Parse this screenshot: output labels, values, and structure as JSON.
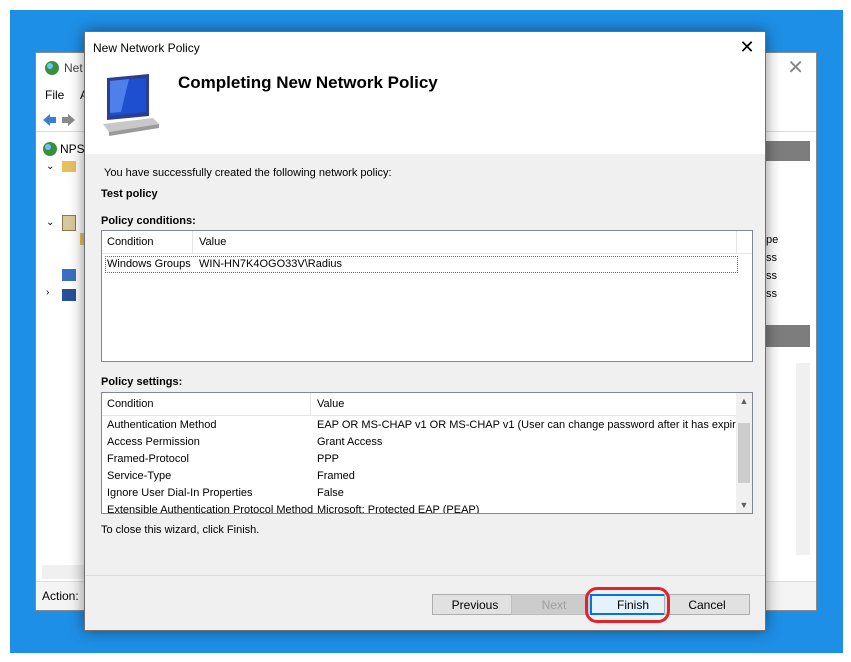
{
  "background_window": {
    "title": "Net",
    "menu": [
      "File",
      "A"
    ],
    "tree_root": "NPS",
    "right_items": [
      "pe",
      "ss",
      "ss",
      "ss"
    ],
    "status_label": "Action:"
  },
  "dialog": {
    "title": "New Network Policy",
    "heading": "Completing New Network Policy",
    "intro": "You have successfully created the following network policy:",
    "policy_name": "Test policy",
    "conditions_label": "Policy conditions:",
    "conditions_columns": [
      "Condition",
      "Value"
    ],
    "conditions_rows": [
      {
        "condition": "Windows Groups",
        "value": "WIN-HN7K4OGO33V\\Radius"
      }
    ],
    "settings_label": "Policy settings:",
    "settings_columns": [
      "Condition",
      "Value"
    ],
    "settings_rows": [
      {
        "condition": "Authentication Method",
        "value": "EAP OR MS-CHAP v1 OR MS-CHAP v1 (User can change password after it has expir..."
      },
      {
        "condition": "Access Permission",
        "value": "Grant Access"
      },
      {
        "condition": "Framed-Protocol",
        "value": "PPP"
      },
      {
        "condition": "Service-Type",
        "value": "Framed"
      },
      {
        "condition": "Ignore User Dial-In Properties",
        "value": "False"
      },
      {
        "condition": "Extensible Authentication Protocol Method",
        "value": "Microsoft: Protected EAP (PEAP)"
      }
    ],
    "closing_text": "To close this wizard, click Finish.",
    "buttons": {
      "previous": "Previous",
      "next": "Next",
      "finish": "Finish",
      "cancel": "Cancel"
    }
  },
  "colors": {
    "desktop": "#1e8fe6",
    "highlight": "#e2242a",
    "default_button_border": "#0078d7"
  }
}
